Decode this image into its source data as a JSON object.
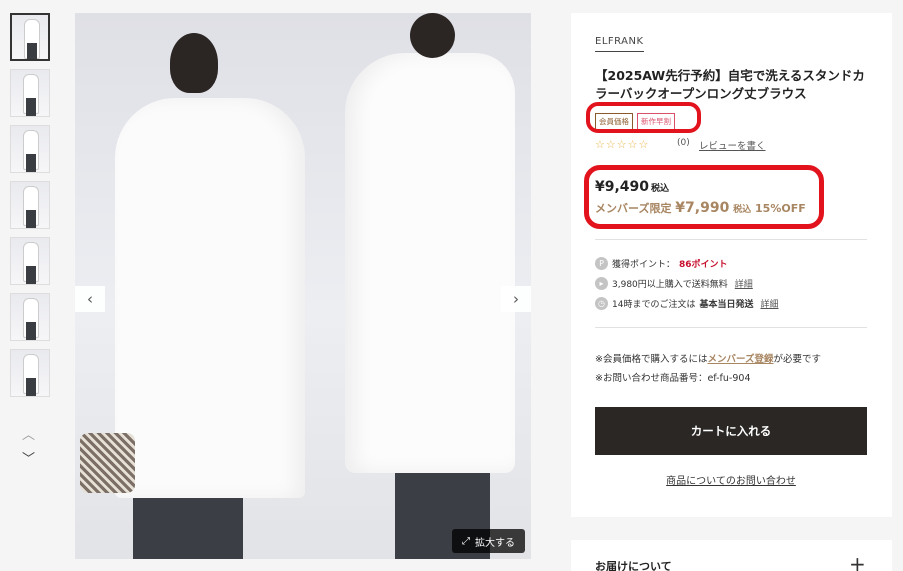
{
  "gallery": {
    "thumbnail_count": 7,
    "active_index": 0,
    "zoom_label": "拡大する",
    "zoom_icon": "expand-icon",
    "prev_icon": "chevron-left-icon",
    "next_icon": "chevron-right-icon",
    "thumbs_up_icon": "chevron-up-icon",
    "thumbs_down_icon": "chevron-down-icon"
  },
  "product": {
    "brand": "ELFRANK",
    "title": "【2025AW先行予約】自宅で洗えるスタンドカラーバックオープンロング丈ブラウス",
    "badges": [
      "会員価格",
      "新作早割"
    ],
    "rating_stars": 0,
    "review_count": "(0)",
    "review_link": "レビューを書く",
    "price": "¥9,490",
    "price_tax": "税込",
    "member_label": "メンバーズ限定",
    "member_price": "¥7,990",
    "member_tax": "税込",
    "discount": "15%OFF"
  },
  "info": {
    "points_label": "獲得ポイント：",
    "points_value": "86ポイント",
    "shipping_text": "3,980円以上購入で送料無料",
    "shipping_detail": "詳細",
    "sameday_pre": "14時までのご注文は",
    "sameday_bold": "基本当日発送",
    "sameday_detail": "詳細"
  },
  "notes": {
    "member_note_pre": "※会員価格で購入するには",
    "member_note_link": "メンバーズ登録",
    "member_note_post": "が必要です",
    "item_code": "※お問い合わせ商品番号：ef-fu-904"
  },
  "actions": {
    "cart_button": "カートに入れる",
    "contact_link": "商品についてのお問い合わせ"
  },
  "delivery": {
    "label": "お届けについて"
  },
  "colors": {
    "accent_member": "#a88662",
    "points_red": "#c8102e",
    "highlight_ring": "#e2131d",
    "cart_bg": "#2a2725"
  }
}
